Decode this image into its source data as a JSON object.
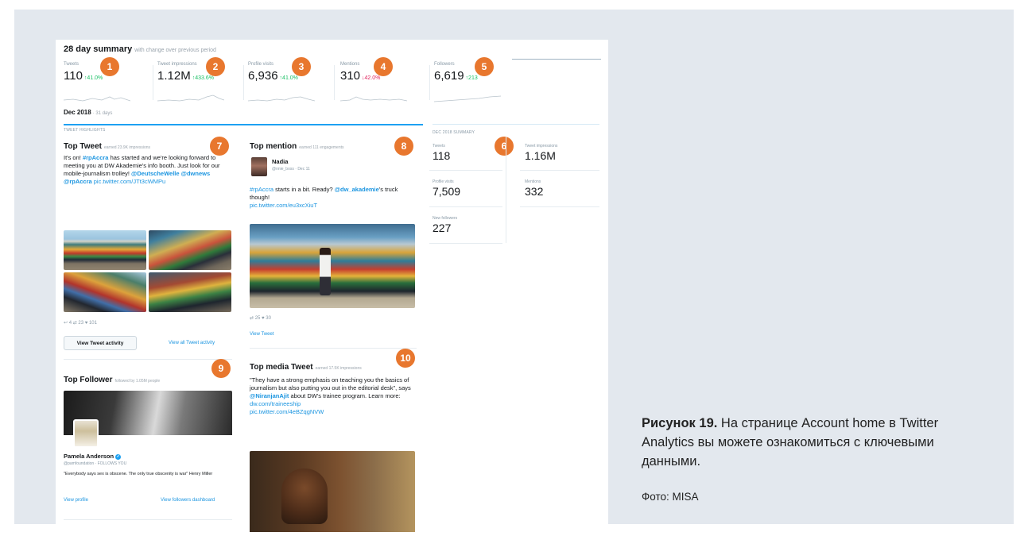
{
  "summary": {
    "title": "28 day summary",
    "subtitle": "with change over previous period",
    "metrics": [
      {
        "label": "Tweets",
        "value": "110",
        "change": "↑41.0%",
        "dir": "up",
        "badge": "1"
      },
      {
        "label": "Tweet impressions",
        "value": "1.12M",
        "change": "↑433.6%",
        "dir": "up",
        "badge": "2"
      },
      {
        "label": "Profile visits",
        "value": "6,936",
        "change": "↑41.0%",
        "dir": "up",
        "badge": "3"
      },
      {
        "label": "Mentions",
        "value": "310",
        "change": "↓42.0%",
        "dir": "down",
        "badge": "4"
      },
      {
        "label": "Followers",
        "value": "6,619",
        "change": "↑213",
        "dir": "up",
        "badge": "5"
      }
    ]
  },
  "month": {
    "title": "Dec 2018",
    "subtitle": "· 31 days"
  },
  "highlights_label": "TWEET HIGHLIGHTS",
  "top_tweet": {
    "title": "Top Tweet",
    "subtitle": "earned 23.9K impressions",
    "badge": "7",
    "text_a": "It's on! ",
    "hashtag": "#rpAccra",
    "text_b": " has started and we're looking forward to meeting you at DW Akademie's info booth. Just look for our mobile-journalism trolley! ",
    "mention1": "@DeutscheWelle",
    "mention2": "@dwnews",
    "mention3": "@rpAccra",
    "pic": "pic.twitter.com/JTt3cWMPu",
    "stats": "↩ 4     ⇄ 23     ♥ 101",
    "button": "View Tweet activity",
    "link": "View all Tweet activity"
  },
  "top_mention": {
    "title": "Top mention",
    "subtitle": "earned 111 engagements",
    "badge": "8",
    "name": "Nadia",
    "handle": "@nnie_boss · Dec 11",
    "hashtag": "#rpAccra",
    "text_a": " starts in a bit. Ready? ",
    "mention": "@dw_akademie",
    "text_b": "'s truck though!",
    "pic": "pic.twitter.com/eu3xcXiuT",
    "stats": "⇄ 25     ♥ 30",
    "link": "View Tweet"
  },
  "top_follower": {
    "title": "Top Follower",
    "subtitle": "followed by 1.05M people",
    "badge": "9",
    "name": "Pamela Anderson",
    "handle": "@pamfoundation · FOLLOWS YOU",
    "bio": "\"Everybody says sex is obscene. The only true obscenity is war\" Henry Miller",
    "link1": "View profile",
    "link2": "View followers dashboard"
  },
  "top_media": {
    "title": "Top media Tweet",
    "subtitle": "earned 17.5K impressions",
    "badge": "10",
    "text_a": "\"They have a strong emphasis on teaching you the basics of journalism but also putting you out in the editorial desk\", says ",
    "mention": "@NiranjanAjit",
    "text_b": " about DW's trainee program. Learn more: ",
    "link": "dw.com/traineeship",
    "pic": "pic.twitter.com/4eBZqgNVW"
  },
  "dec_summary": {
    "title": "DEC 2018 SUMMARY",
    "badge": "6",
    "stats": [
      {
        "label": "Tweets",
        "value": "118"
      },
      {
        "label": "Tweet impressions",
        "value": "1.16M"
      },
      {
        "label": "Profile visits",
        "value": "7,509"
      },
      {
        "label": "Mentions",
        "value": "332"
      },
      {
        "label": "New followers",
        "value": "227"
      }
    ]
  },
  "caption": {
    "label": "Рисунок 19.",
    "text": " На странице Account home в Twitter Analytics вы можете ознакомиться с ключевыми данными.",
    "credit": "Фото: MISA"
  },
  "colors": {
    "accent": "#1da1f2",
    "badge": "#e8772e",
    "up": "#17bf63",
    "down": "#e0245e"
  }
}
